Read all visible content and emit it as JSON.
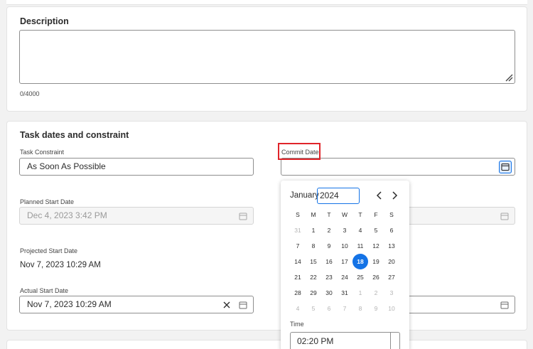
{
  "description": {
    "title": "Description",
    "counter": "0/4000"
  },
  "task_dates": {
    "title": "Task dates and constraint",
    "task_constraint": {
      "label": "Task Constraint",
      "value": "As Soon As Possible"
    },
    "commit_date": {
      "label": "Commit Date",
      "value": ""
    },
    "planned_start": {
      "label": "Planned Start Date",
      "value": "Dec 4, 2023 3:42 PM"
    },
    "projected_start": {
      "label": "Projected Start Date",
      "value": "Nov 7, 2023 10:29 AM"
    },
    "actual_start": {
      "label": "Actual Start Date",
      "value": "Nov 7, 2023 10:29 AM"
    }
  },
  "calendar": {
    "month": "January",
    "year": "2024",
    "weekdays": [
      "S",
      "M",
      "T",
      "W",
      "T",
      "F",
      "S"
    ],
    "weeks": [
      [
        "31",
        "1",
        "2",
        "3",
        "4",
        "5",
        "6"
      ],
      [
        "7",
        "8",
        "9",
        "10",
        "11",
        "12",
        "13"
      ],
      [
        "14",
        "15",
        "16",
        "17",
        "18",
        "19",
        "20"
      ],
      [
        "21",
        "22",
        "23",
        "24",
        "25",
        "26",
        "27"
      ],
      [
        "28",
        "29",
        "30",
        "31",
        "1",
        "2",
        "3"
      ],
      [
        "4",
        "5",
        "6",
        "7",
        "8",
        "9",
        "10"
      ]
    ],
    "selected_day": "18",
    "time_label": "Time",
    "time_value": "02:20 PM"
  },
  "colors": {
    "accent": "#1473e6",
    "highlight": "#e0242a"
  },
  "icons": {
    "calendar": "calendar-icon",
    "clear": "clear-icon",
    "prev": "chevron-left-icon",
    "next": "chevron-right-icon",
    "resize": "resize-grip-icon"
  }
}
